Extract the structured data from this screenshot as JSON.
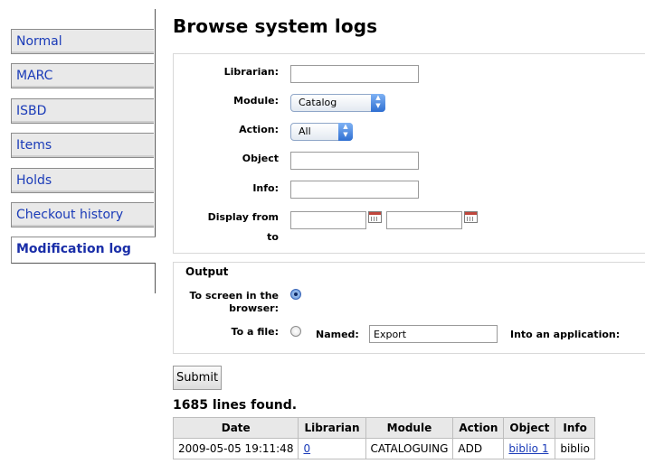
{
  "sidebar": {
    "tabs": [
      {
        "label": "Normal"
      },
      {
        "label": "MARC"
      },
      {
        "label": "ISBD"
      },
      {
        "label": "Items"
      },
      {
        "label": "Holds"
      },
      {
        "label": "Checkout history"
      },
      {
        "label": "Modification log",
        "active": true
      }
    ]
  },
  "page": {
    "title": "Browse system logs"
  },
  "filters": {
    "librarian_label": "Librarian:",
    "librarian_value": "",
    "module_label": "Module:",
    "module_value": "Catalog",
    "action_label": "Action:",
    "action_value": "All",
    "object_label": "Object",
    "object_value": "",
    "info_label": "Info:",
    "info_value": "",
    "display_from_label": "Display from",
    "to_label": "to",
    "from_value": "",
    "to_value": ""
  },
  "output": {
    "legend": "Output",
    "screen_label_line1": "To screen in the",
    "screen_label_line2": "browser:",
    "screen_selected": true,
    "file_label": "To a file:",
    "named_label": "Named:",
    "named_value": "Export",
    "application_label": "Into an application:"
  },
  "submit_label": "Submit",
  "results": {
    "count_text": "1685 lines found.",
    "columns": [
      "Date",
      "Librarian",
      "Module",
      "Action",
      "Object",
      "Info"
    ],
    "rows": [
      {
        "date": "2009-05-05 19:11:48",
        "librarian": "0",
        "module": "CATALOGUING",
        "action": "ADD",
        "object": "biblio 1",
        "info": "biblio"
      }
    ]
  },
  "icons": {
    "calendar": "calendar-icon",
    "select_arrows": "updown-arrows-icon"
  }
}
